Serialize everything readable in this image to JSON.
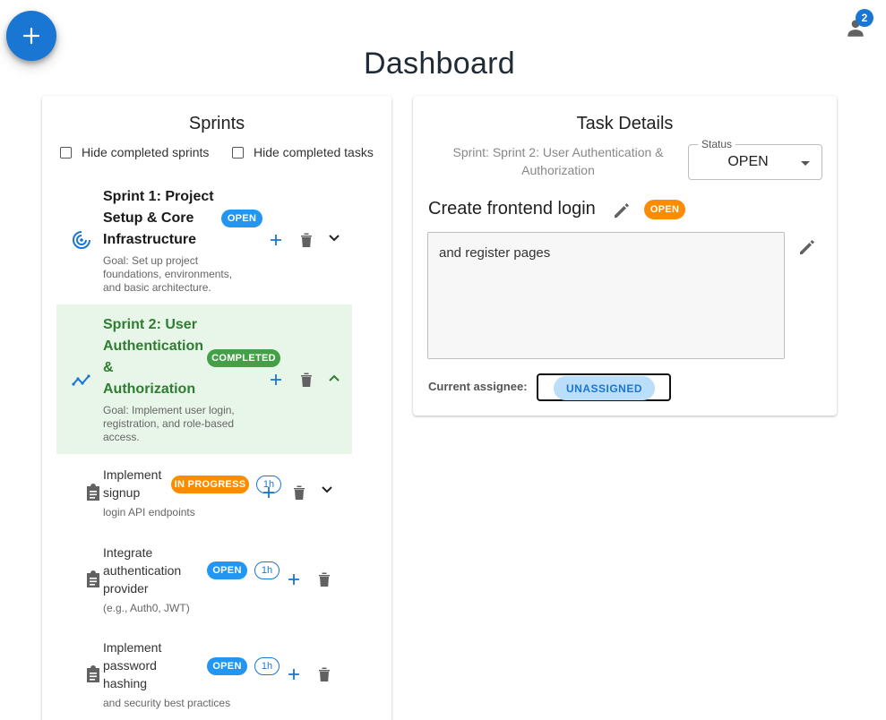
{
  "header": {
    "title": "Dashboard",
    "notification_count": "2",
    "add_button_icon": "plus-icon",
    "user_icon": "person-icon"
  },
  "sprints_panel": {
    "title": "Sprints",
    "filters": [
      {
        "label": "Hide completed sprints",
        "checked": false
      },
      {
        "label": "Hide completed tasks",
        "checked": false
      }
    ],
    "sprints": [
      {
        "title_lines": [
          "Sprint 1: Project",
          "Setup & Core",
          "Infrastructure"
        ],
        "status": "OPEN",
        "goal_lines": [
          "Goal: Set up project",
          "foundations, environments,",
          "and basic architecture."
        ],
        "icon": "target-icon",
        "expanded": false
      },
      {
        "title_lines": [
          "Sprint 2: User",
          "Authentication",
          "&",
          "Authorization"
        ],
        "status": "COMPLETED",
        "goal_lines": [
          "Goal: Implement user login,",
          "registration, and role-based",
          "access."
        ],
        "icon": "timeline-icon",
        "expanded": true
      }
    ],
    "tasks": [
      {
        "title_lines": [
          "Implement",
          "signup"
        ],
        "desc": "login API endpoints",
        "status": "IN PROGRESS",
        "estimate": "1h",
        "icon": "clipboard-icon"
      },
      {
        "title_lines": [
          "Integrate",
          "authentication",
          "provider"
        ],
        "desc": "(e.g., Auth0, JWT)",
        "status": "OPEN",
        "estimate": "1h",
        "icon": "clipboard-icon"
      },
      {
        "title_lines": [
          "Implement",
          "password",
          "hashing"
        ],
        "desc": "and security best practices",
        "status": "OPEN",
        "estimate": "1h",
        "icon": "clipboard-icon"
      }
    ]
  },
  "details_panel": {
    "title": "Task Details",
    "sprint_line_1": "Sprint: Sprint 2: User Authentication &",
    "sprint_line_2": "Authorization",
    "status_label": "Status",
    "status_value": "OPEN",
    "task_title": "Create frontend login",
    "task_status": "OPEN",
    "description": "and register pages",
    "assignee_label": "Current assignee:",
    "assignee_value": "UNASSIGNED"
  },
  "colors": {
    "primary": "#1976d2",
    "open": "#2196f3",
    "completed": "#43a047",
    "in_progress": "#fb8c00",
    "highlight": "#e8f5e9"
  }
}
